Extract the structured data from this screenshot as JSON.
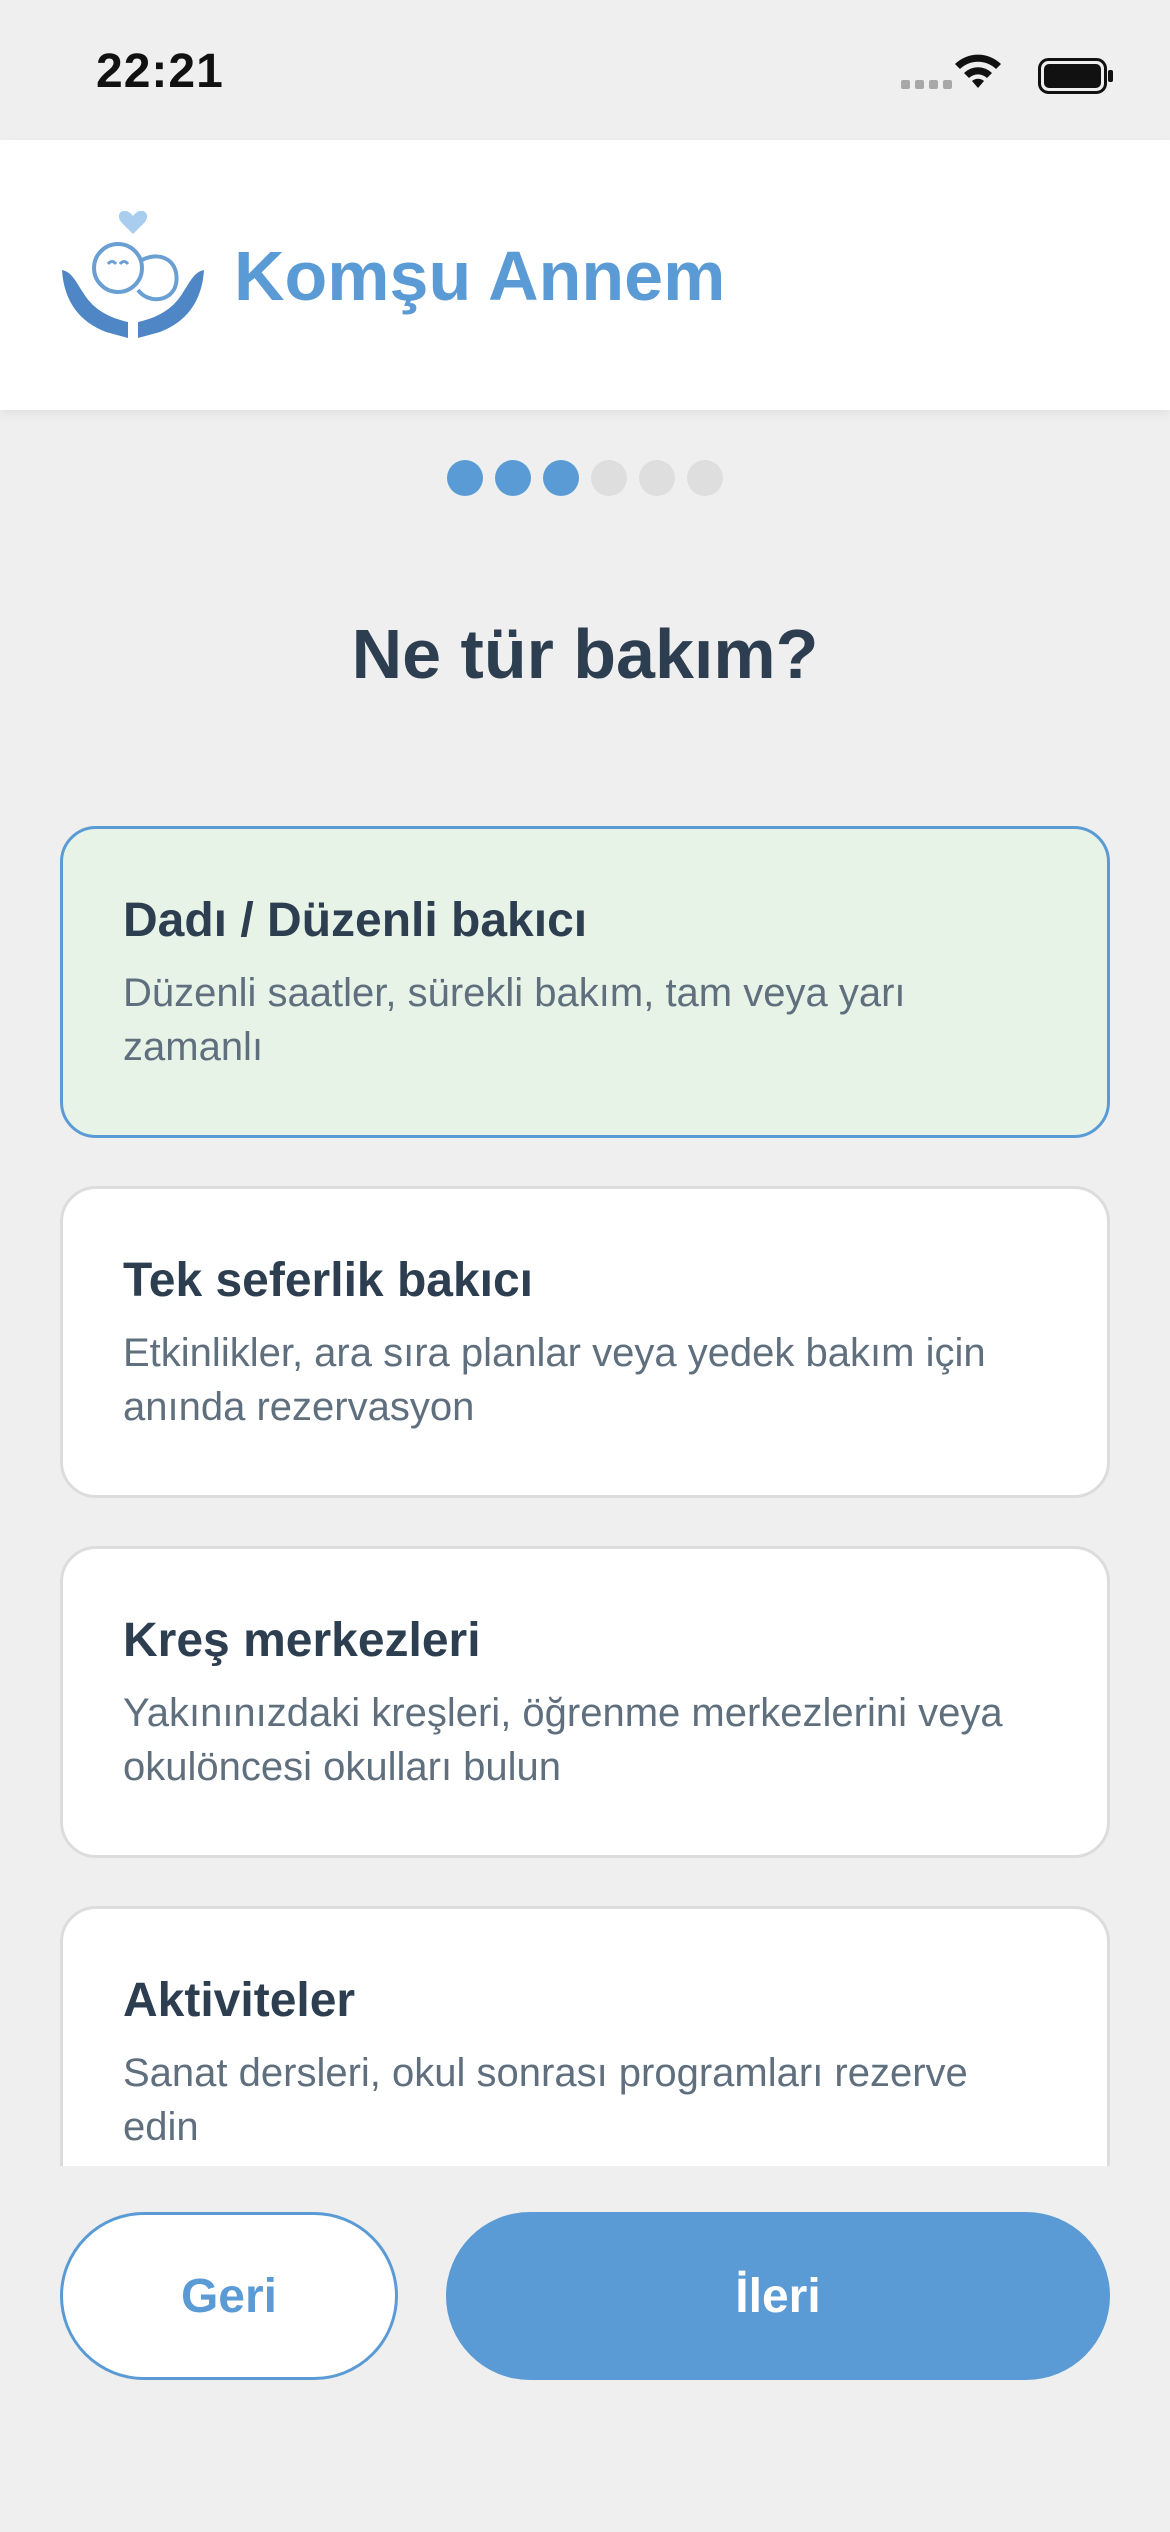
{
  "status_bar": {
    "time": "22:21"
  },
  "header": {
    "brand": "Komşu Annem"
  },
  "progress": {
    "total_steps": 6,
    "current_step": 3
  },
  "question": "Ne tür bakım?",
  "options": [
    {
      "title": "Dadı / Düzenli bakıcı",
      "desc": "Düzenli saatler, sürekli bakım, tam veya yarı zamanlı",
      "selected": true
    },
    {
      "title": "Tek seferlik bakıcı",
      "desc": "Etkinlikler, ara sıra planlar veya yedek bakım için anında rezervasyon",
      "selected": false
    },
    {
      "title": "Kreş merkezleri",
      "desc": "Yakınınızdaki kreşleri, öğrenme merkezlerini veya okulöncesi okulları bulun",
      "selected": false
    },
    {
      "title": "Aktiviteler",
      "desc": "Sanat dersleri, okul sonrası programları rezerve edin",
      "selected": false
    }
  ],
  "buttons": {
    "back": "Geri",
    "next": "İleri"
  },
  "colors": {
    "accent": "#5b9bd5",
    "selected_bg": "#e8f3e8",
    "heading": "#2c3e50"
  },
  "icons": {
    "logo": "baby-in-hands-icon",
    "wifi": "wifi-icon",
    "battery": "battery-icon"
  }
}
